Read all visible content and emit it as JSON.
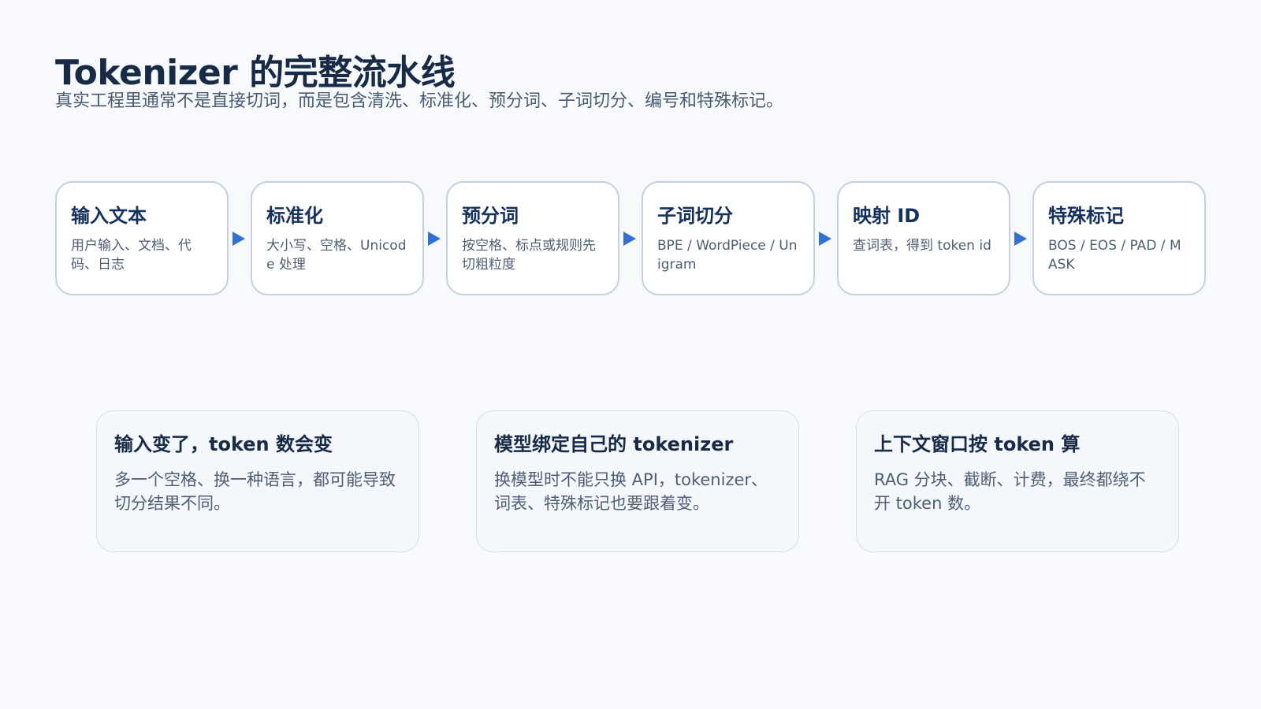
{
  "header": {
    "title": "Tokenizer 的完整流水线",
    "subtitle": "真实工程里通常不是直接切词，而是包含清洗、标准化、预分词、子词切分、编号和特殊标记。"
  },
  "pipeline": {
    "steps": [
      {
        "title": "输入文本",
        "desc": "用户输入、文档、代码、日志"
      },
      {
        "title": "标准化",
        "desc": "大小写、空格、Unicode 处理"
      },
      {
        "title": "预分词",
        "desc": "按空格、标点或规则先切粗粒度"
      },
      {
        "title": "子词切分",
        "desc": "BPE / WordPiece / Unigram"
      },
      {
        "title": "映射 ID",
        "desc": "查词表，得到 token id"
      },
      {
        "title": "特殊标记",
        "desc": "BOS / EOS / PAD / MASK"
      }
    ]
  },
  "cards": [
    {
      "title": "输入变了，token 数会变",
      "body": "多一个空格、换一种语言，都可能导致切分结果不同。"
    },
    {
      "title": "模型绑定自己的 tokenizer",
      "body": "换模型时不能只换 API，tokenizer、词表、特殊标记也要跟着变。"
    },
    {
      "title": "上下文窗口按 token 算",
      "body": "RAG 分块、截断、计费，最终都绕不开 token 数。"
    }
  ],
  "colors": {
    "arrow": "#2f6fd6",
    "step_border": "#c3d0e2",
    "title": "#172a46"
  }
}
